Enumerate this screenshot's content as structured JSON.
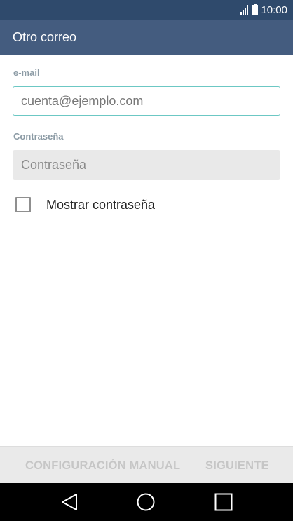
{
  "status_bar": {
    "time": "10:00",
    "signal_icon": "signal-icon",
    "battery_icon": "battery-icon"
  },
  "app_bar": {
    "title": "Otro correo"
  },
  "form": {
    "email_label": "e-mail",
    "email_placeholder": "cuenta@ejemplo.com",
    "password_label": "Contraseña",
    "password_placeholder": "Contraseña",
    "show_password_label": "Mostrar contraseña",
    "show_password_checked": false
  },
  "actions": {
    "manual_label": "CONFIGURACIÓN MANUAL",
    "next_label": "SIGUIENTE"
  },
  "nav": {
    "back_icon": "back-icon",
    "home_icon": "home-icon",
    "recents_icon": "recents-icon"
  },
  "colors": {
    "status_bar": "#2f4a6c",
    "app_bar": "#445c7f",
    "focus_border": "#6cc8c4",
    "disabled_text": "#c6c6c6"
  }
}
